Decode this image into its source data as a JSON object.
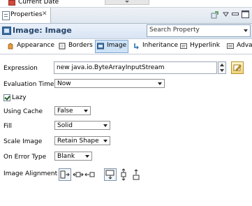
{
  "top_strip": {
    "label": "Current Date"
  },
  "view_tab": {
    "title": "Properties",
    "close_glyph": "✕"
  },
  "header": {
    "title": "Image: Image"
  },
  "search": {
    "placeholder": "Search Property"
  },
  "category_tabs": [
    {
      "label": "Appearance",
      "icon": "appearance-icon"
    },
    {
      "label": "Borders",
      "icon": "borders-icon"
    },
    {
      "label": "Image",
      "icon": "image-icon",
      "selected": true
    },
    {
      "label": "Inheritance",
      "icon": "inheritance-icon"
    },
    {
      "label": "Hyperlink",
      "icon": "hyperlink-icon"
    },
    {
      "label": "Adva",
      "icon": "advanced-icon"
    }
  ],
  "form": {
    "expression": {
      "label": "Expression",
      "value": "new java.io.ByteArrayInputStream"
    },
    "evaluation_time": {
      "label": "Evaluation Time",
      "value": "Now"
    },
    "lazy": {
      "label": "Lazy",
      "checked": true
    },
    "using_cache": {
      "label": "Using Cache",
      "value": "False"
    },
    "fill": {
      "label": "Fill",
      "value": "Solid"
    },
    "scale_image": {
      "label": "Scale Image",
      "value": "Retain Shape"
    },
    "on_error_type": {
      "label": "On Error Type",
      "value": "Blank"
    },
    "image_alignment": {
      "label": "Image Alignment"
    }
  },
  "colors": {
    "header_title": "#27466b",
    "selected_tab_bg": "#cfe3f7"
  }
}
